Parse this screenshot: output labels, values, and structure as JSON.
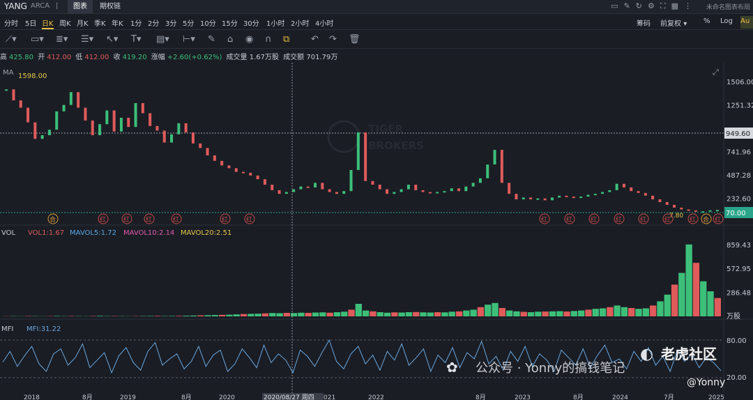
{
  "header": {
    "ticker": "YANG",
    "exchange": "ARCA",
    "sep": "|",
    "tabs": [
      "图表",
      "期权链"
    ],
    "right_title": "未命名图表布局"
  },
  "periods": [
    "分时",
    "5日",
    "日K",
    "周K",
    "月K",
    "季K",
    "年K",
    "1分",
    "2分",
    "3分",
    "5分",
    "10分",
    "15分",
    "30分",
    "1小时",
    "2小时",
    "4小时"
  ],
  "right_controls": {
    "chips": "筹码",
    "adjust": "前复权",
    "percent": "%",
    "log": "Log",
    "auto": "Au"
  },
  "info": {
    "high_l": "高",
    "high": "425.80",
    "open_l": "开",
    "open": "412.00",
    "low_l": "低",
    "low": "412.00",
    "close_l": "收",
    "close": "419.20",
    "chg_l": "涨幅",
    "chg": "+2.60(+0.62%)",
    "vol": "成交量 1.67万股",
    "amt": "成交额 701.79万"
  },
  "price_panel": {
    "ma_label": "MA",
    "hl_label": "1598.00",
    "current_tag": "949.60",
    "low_tag": "70.00",
    "low_mark": "7.80",
    "y_ticks": [
      "1506.00",
      "1251.32",
      "741.96",
      "487.28",
      "232.60"
    ],
    "watermark_1": "TIGER",
    "watermark_2": "BROKERS",
    "event_markers": [
      "合",
      "红",
      "红",
      "红",
      "红",
      "红",
      "红",
      "红",
      "红",
      "红",
      "红",
      "红",
      "红",
      "红",
      "合",
      "红"
    ]
  },
  "vol_panel": {
    "title": "VOL",
    "vol1": "VOL1:1.67",
    "mavol5": "MAVOL5:1.72",
    "mavol10": "MAVOL10:2.14",
    "mavol20": "MAVOL20:2.51",
    "y_ticks": [
      "859.43",
      "572.95",
      "286.48"
    ],
    "unit": "万股"
  },
  "mfi_panel": {
    "title": "MFI",
    "value": "MFI:31.22",
    "y_ticks": [
      "80.00",
      "20.00"
    ]
  },
  "x_axis": {
    "labels": [
      "2018",
      "8月",
      "2019",
      "8月",
      "2020",
      "8月",
      "2022",
      "8月",
      "2023",
      "8月",
      "2024",
      "7月",
      "2025"
    ],
    "cursor_date": "2020/08/27 周四",
    "cursor_tail": "021"
  },
  "overlay": {
    "wechat": "公众号 · Yonny的搞钱笔记",
    "brand": "老虎社区",
    "handle": "@Yonny"
  },
  "colors": {
    "up": "#3dbf7a",
    "down": "#e05b5b",
    "mavol5": "#5aa9e6",
    "mavol10": "#e05bb0",
    "mavol20": "#e6c84a",
    "mfi": "#6aa8e0",
    "accent": "#f0c040"
  },
  "chart_data": {
    "type": "line",
    "price_series": {
      "name": "YANG",
      "values": [
        1420,
        1300,
        1220,
        1060,
        880,
        920,
        980,
        1180,
        1250,
        1390,
        1220,
        1080,
        920,
        1040,
        1190,
        960,
        1110,
        1010,
        1270,
        1160,
        1020,
        970,
        840,
        930,
        1050,
        950,
        830,
        780,
        700,
        640,
        590,
        560,
        520,
        510,
        480,
        440,
        380,
        320,
        280,
        300,
        330,
        360,
        350,
        400,
        330,
        300,
        280,
        310,
        540,
        950,
        420,
        380,
        330,
        280,
        300,
        330,
        380,
        320,
        300,
        290,
        300,
        310,
        340,
        310,
        360,
        400,
        450,
        600,
        760,
        400,
        280,
        220,
        240,
        220,
        230,
        210,
        240,
        260,
        250,
        240,
        250,
        270,
        280,
        300,
        320,
        390,
        350,
        310,
        290,
        260,
        220,
        190,
        160,
        130,
        110,
        100,
        85,
        90,
        100,
        105
      ]
    },
    "vol_series": {
      "name": "VOL",
      "values": [
        2,
        3,
        2,
        4,
        3,
        2,
        3,
        5,
        3,
        4,
        3,
        2,
        4,
        6,
        3,
        4,
        3,
        2,
        3,
        4,
        5,
        6,
        4,
        5,
        6,
        8,
        10,
        12,
        14,
        16,
        18,
        20,
        24,
        28,
        30,
        32,
        36,
        40,
        38,
        42,
        40,
        44,
        42,
        46,
        48,
        44,
        50,
        56,
        80,
        150,
        70,
        60,
        50,
        44,
        48,
        46,
        50,
        52,
        48,
        46,
        50,
        48,
        56,
        60,
        70,
        80,
        110,
        140,
        160,
        100,
        70,
        60,
        54,
        50,
        56,
        58,
        60,
        62,
        58,
        64,
        70,
        80,
        90,
        96,
        110,
        130,
        110,
        100,
        90,
        96,
        130,
        180,
        260,
        380,
        520,
        860,
        640,
        420,
        300,
        220
      ]
    },
    "mfi_series": {
      "name": "MFI",
      "values": [
        45,
        62,
        38,
        55,
        70,
        42,
        30,
        58,
        66,
        40,
        52,
        74,
        36,
        48,
        60,
        28,
        55,
        68,
        44,
        32,
        62,
        76,
        40,
        50,
        58,
        34,
        46,
        70,
        38,
        56,
        64,
        30,
        42,
        66,
        52,
        36,
        72,
        44,
        58,
        48,
        28,
        64,
        54,
        38,
        60,
        80,
        46,
        34,
        58,
        70,
        42,
        56,
        32,
        62,
        48,
        74,
        40,
        52,
        66,
        30,
        56,
        44,
        68,
        36,
        60,
        50,
        78,
        42,
        54,
        32,
        62,
        46,
        70,
        38,
        58,
        48,
        30,
        64,
        52,
        40,
        66,
        36,
        56,
        72,
        44,
        50,
        34,
        62,
        46,
        68,
        40,
        54,
        30,
        64,
        46,
        58,
        36,
        52,
        44,
        31
      ]
    },
    "price_range": [
      0,
      1650
    ],
    "vol_range": [
      0,
      950
    ],
    "mfi_range": [
      0,
      100
    ]
  }
}
